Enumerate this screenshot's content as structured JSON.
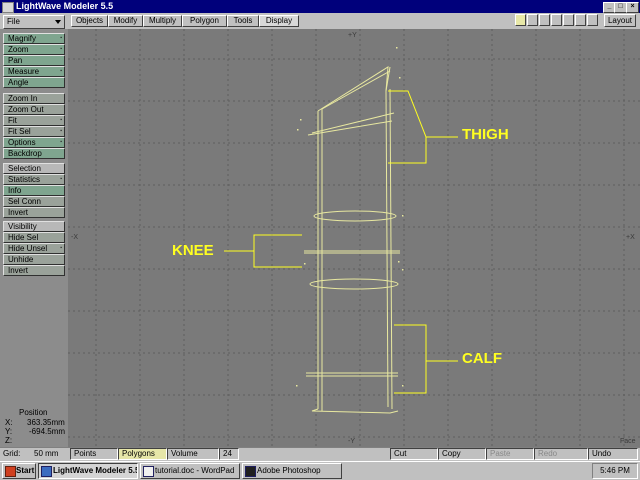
{
  "window": {
    "title": "LightWave Modeler 5.5",
    "controls": [
      "_",
      "□",
      "×"
    ]
  },
  "menu": {
    "file_label": "File",
    "tabs": [
      "Objects",
      "Modify",
      "Multiply",
      "Polygon",
      "Tools",
      "Display"
    ],
    "active_tab": "Display",
    "layout_label": "Layout"
  },
  "sidebar": {
    "groups": [
      [
        "Magnify",
        "Zoom",
        "Pan",
        "Measure",
        "Angle"
      ],
      [
        "Zoom In",
        "Zoom Out",
        "Fit",
        "Fit Sel",
        "Options",
        "Backdrop"
      ],
      [
        "Selection",
        "Statistics",
        "Info",
        "Sel Conn",
        "Invert"
      ],
      [
        "Visibility",
        "Hide Sel",
        "Hide Unsel",
        "Unhide",
        "Invert"
      ]
    ]
  },
  "position": {
    "title": "Position",
    "x_label": "X:",
    "x": "363.35mm",
    "y_label": "Y:",
    "y": "-694.5mm",
    "z_label": "Z:"
  },
  "viewport": {
    "top_axis": "+Y",
    "bottom_axis": "-Y",
    "left_axis": "-X",
    "right_axis": "+X",
    "view_name": "Face",
    "labels": {
      "thigh": "THIGH",
      "knee": "KNEE",
      "calf": "CALF"
    },
    "colors": {
      "bg": "#7a7a7a",
      "grid": "#5e5e5e",
      "mesh": "#e8e8a0",
      "label": "#ffff20"
    }
  },
  "statusbar": {
    "grid_label": "Grid:",
    "grid_value": "50 mm",
    "modes": [
      "Points",
      "Polygons",
      "Volume"
    ],
    "selected_mode": "Polygons",
    "count": "24",
    "edit": [
      "Cut",
      "Copy",
      "Paste",
      "Redo",
      "Undo"
    ]
  },
  "taskbar": {
    "start": "Start",
    "tasks": [
      "LightWave Modeler 5.5",
      "tutorial.doc - WordPad",
      "Adobe Photoshop"
    ],
    "clock": "5:46 PM"
  }
}
